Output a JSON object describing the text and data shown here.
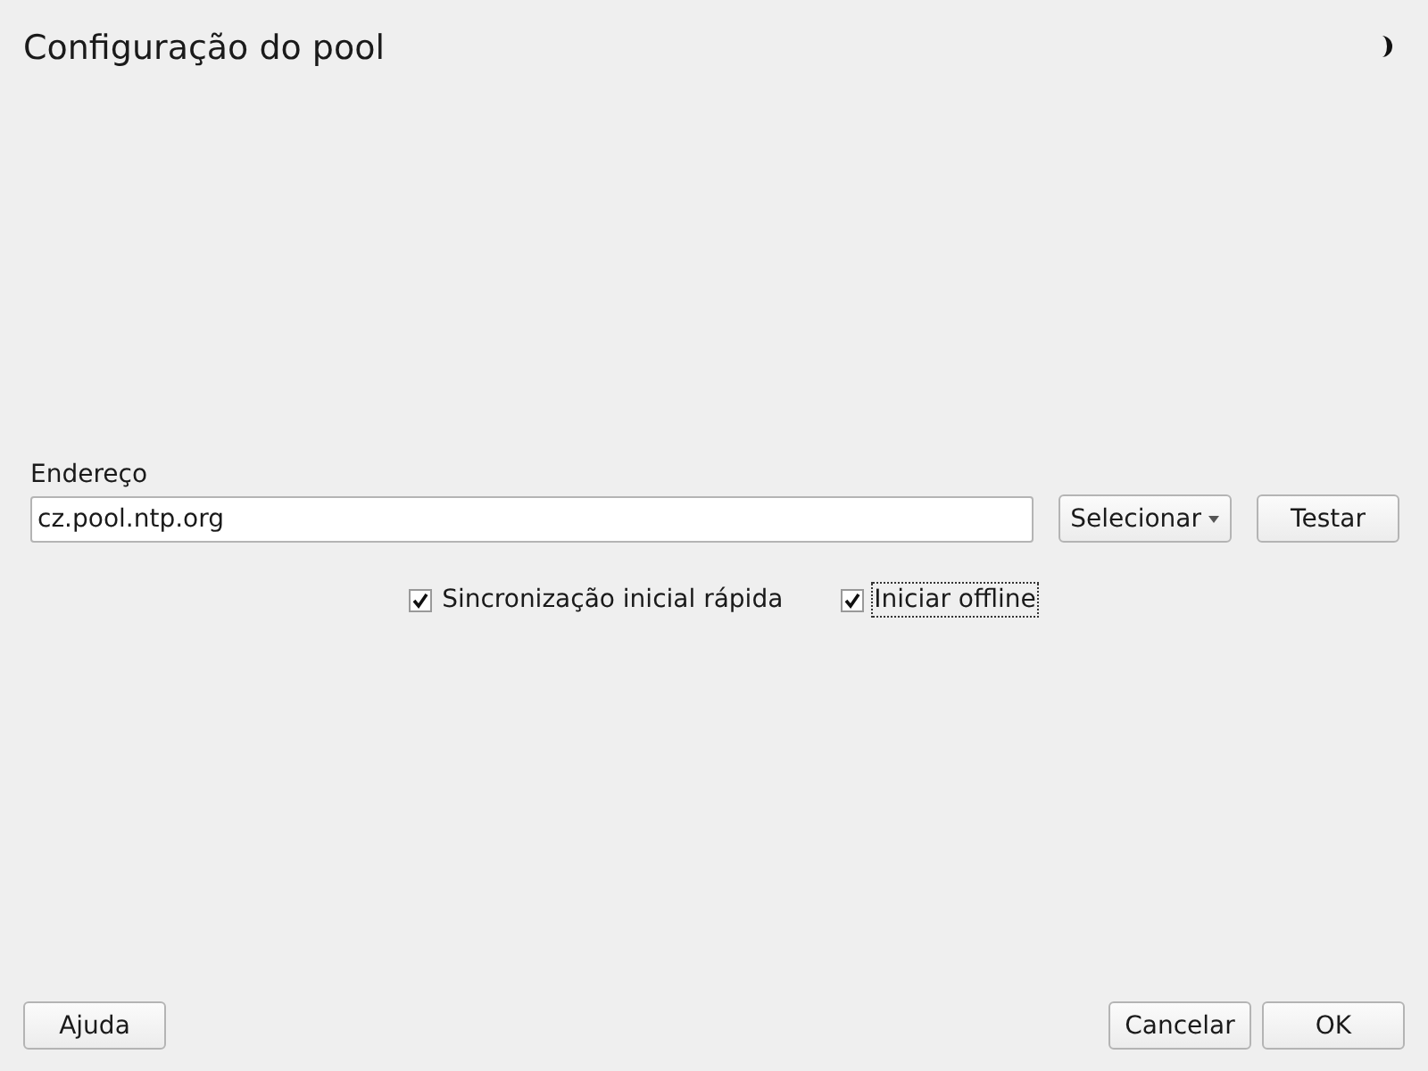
{
  "window": {
    "title": "Configuração do pool"
  },
  "address": {
    "label": "Endereço",
    "value": "cz.pool.ntp.org"
  },
  "buttons": [
    {
      "label": "Selecionar",
      "kind": "dropdown"
    },
    {
      "label": "Testar",
      "kind": "plain"
    }
  ],
  "options": [
    {
      "label": "Sincronização inicial rápida",
      "checked": true,
      "focused": false
    },
    {
      "label": "Iniciar offline",
      "checked": true,
      "focused": true
    }
  ],
  "footer": {
    "left": [
      "Ajuda"
    ],
    "right": [
      "Cancelar",
      "OK"
    ]
  }
}
